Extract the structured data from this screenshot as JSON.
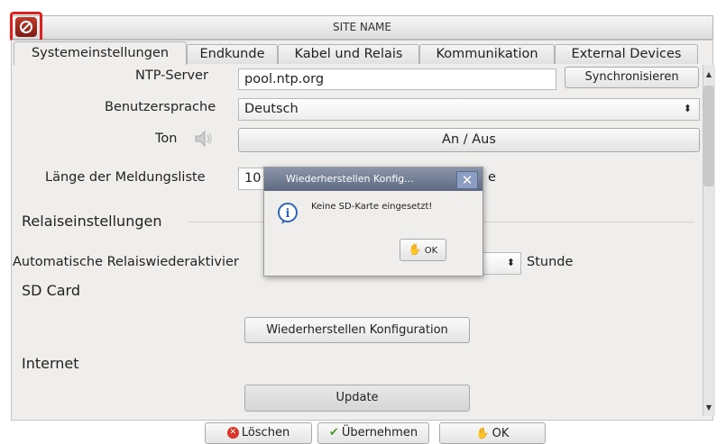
{
  "window": {
    "site_name": "SITE NAME",
    "app_icon": "app-logo-icon"
  },
  "tabs": [
    {
      "label": "Systemeinstellungen",
      "active": true
    },
    {
      "label": "Endkunde",
      "active": false
    },
    {
      "label": "Kabel und Relais",
      "active": false
    },
    {
      "label": "Kommunikation",
      "active": false
    },
    {
      "label": "External Devices",
      "active": false
    }
  ],
  "settings": {
    "ntp_label": "NTP-Server",
    "ntp_value": "pool.ntp.org",
    "sync_button": "Synchronisieren",
    "language_label": "Benutzersprache",
    "language_value": "Deutsch",
    "sound_label": "Ton",
    "sound_icon": "speaker-icon",
    "sound_toggle": "An / Aus",
    "message_list_label": "Länge der Meldungsliste",
    "message_list_value": "10",
    "message_list_suffix": "e"
  },
  "relay": {
    "section_title": "Relaiseinstellungen",
    "auto_label": "Automatische Relaiswiederaktivier",
    "unit": "Stunde"
  },
  "sdcard": {
    "section_title": "SD Card",
    "restore_button": "Wiederherstellen Konfiguration"
  },
  "internet": {
    "section_title": "Internet",
    "update_button": "Update"
  },
  "dialog": {
    "title": "Wiederherstellen Konfig...",
    "message": "Keine SD-Karte eingesetzt!",
    "ok_label": "OK",
    "icon": "info-icon"
  },
  "footer": {
    "delete_label": "Löschen",
    "apply_label": "Übernehmen",
    "ok_label": "OK"
  },
  "colors": {
    "highlight": "#e01f1f",
    "dialog_title": "#6c778d"
  }
}
